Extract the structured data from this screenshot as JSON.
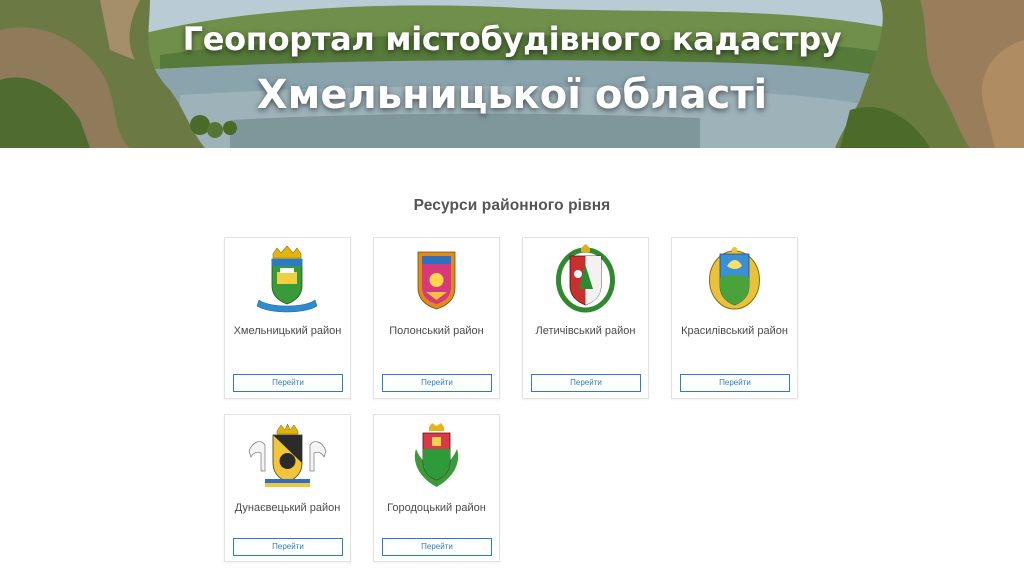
{
  "hero": {
    "title_line1": "Геопортал містобудівного кадастру",
    "title_line2": "Хмельницької області"
  },
  "section": {
    "title": "Ресурси районного рівня"
  },
  "colors": {
    "button_accent": "#2a7fc1",
    "card_border": "#e3e3e3"
  },
  "districts": [
    {
      "name": "Хмельницький район",
      "button": "Перейти",
      "emblem_icon": "khmelnytskyi-emblem-icon"
    },
    {
      "name": "Полонський район",
      "button": "Перейти",
      "emblem_icon": "polonskyi-emblem-icon"
    },
    {
      "name": "Летичівський район",
      "button": "Перейти",
      "emblem_icon": "letychivskyi-emblem-icon"
    },
    {
      "name": "Красилівський район",
      "button": "Перейти",
      "emblem_icon": "krasylivskyi-emblem-icon"
    },
    {
      "name": "Дунаєвецький район",
      "button": "Перейти",
      "emblem_icon": "dunaievetskyi-emblem-icon"
    },
    {
      "name": "Городоцький район",
      "button": "Перейти",
      "emblem_icon": "horodotskyi-emblem-icon"
    }
  ]
}
